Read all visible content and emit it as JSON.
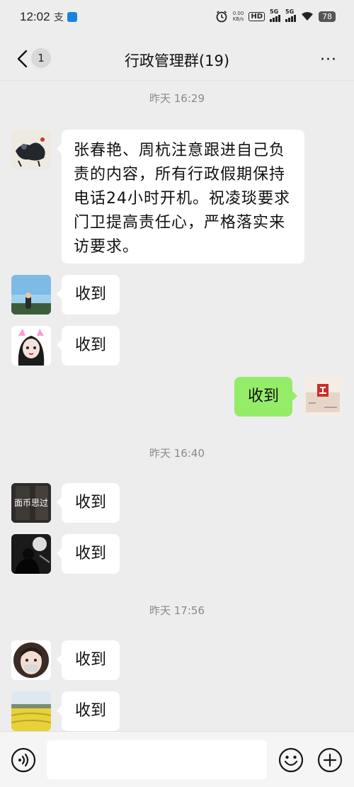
{
  "status_bar": {
    "time": "12:02",
    "notif_char": "支",
    "net_speed_value": "0.00",
    "net_speed_unit": "KB/s",
    "hd_label": "HD",
    "sim1": "5G",
    "sim2": "5G",
    "battery": "78"
  },
  "header": {
    "back_badge": "1",
    "title": "行政管理群(19)",
    "more": "···"
  },
  "timestamps": [
    "昨天 16:29",
    "昨天 16:40",
    "昨天 17:56"
  ],
  "messages": [
    {
      "sender": "other",
      "text": "张春艳、周杭注意跟进自己负责的内容，所有行政假期保持电话24小时开机。祝凌琰要求门卫提高责任心，严格落实来访要求。"
    },
    {
      "sender": "other",
      "text": "收到"
    },
    {
      "sender": "other",
      "text": "收到"
    },
    {
      "sender": "self",
      "text": "收到"
    },
    {
      "sender": "other",
      "avatar_text": "面币思过",
      "text": "收到"
    },
    {
      "sender": "other",
      "text": "收到"
    },
    {
      "sender": "other",
      "text": "收到"
    },
    {
      "sender": "other",
      "text": "收到"
    }
  ],
  "bottom_bar": {
    "voice_icon": "voice-icon",
    "emoji_icon": "emoji-icon",
    "plus_icon": "plus-icon"
  },
  "colors": {
    "background": "#ededed",
    "self_bubble": "#95ec69",
    "other_bubble": "#ffffff"
  }
}
